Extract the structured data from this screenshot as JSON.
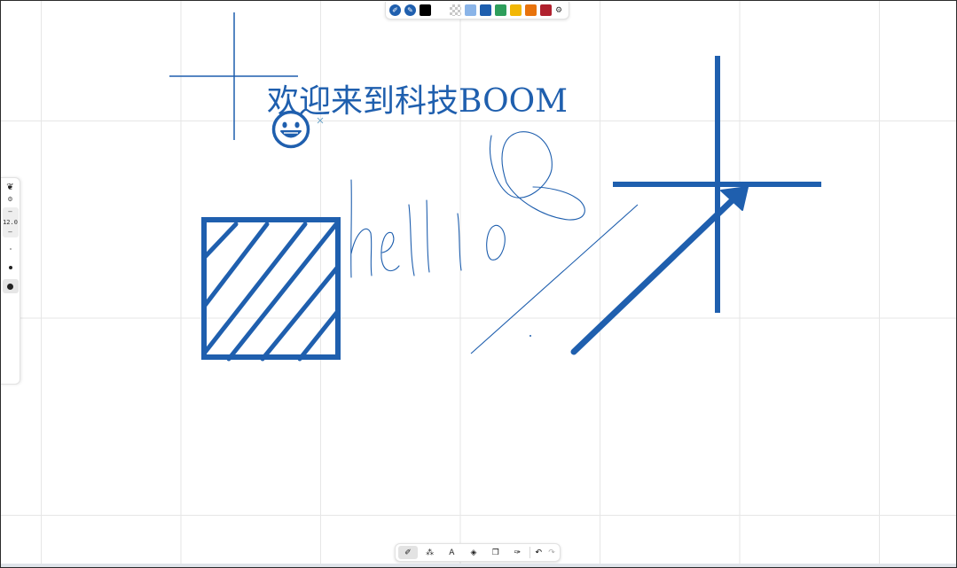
{
  "canvas": {
    "heading_text": "欢迎来到科技BOOM",
    "handwriting_text": "hello",
    "ink_color": "#1f5fae",
    "background": "#ffffff",
    "grid_color": "#e6e6e6"
  },
  "color_toolbar": {
    "modes": [
      {
        "name": "pen-mode-icon",
        "glyph": "✐"
      },
      {
        "name": "marker-mode-icon",
        "glyph": "✎"
      }
    ],
    "swatches": [
      "#000000",
      "#ffffff",
      "transparent",
      "#8ab4e8",
      "#1f5fae",
      "#2e9e5b",
      "#f2b705",
      "#e8730c",
      "#b0212e"
    ],
    "more_glyph": "⚙"
  },
  "stroke_panel": {
    "brush_glyph": "❦",
    "settings_glyph": "⚙",
    "decrease_glyph": "−",
    "size_value": "12.0",
    "increase_glyph": "−"
  },
  "tools_toolbar": {
    "tools": [
      {
        "name": "pen-tool-icon",
        "glyph": "✐"
      },
      {
        "name": "shape-tool-icon",
        "glyph": "⁂"
      },
      {
        "name": "text-tool-icon",
        "glyph": "A"
      },
      {
        "name": "eraser-tool-icon",
        "glyph": "◈"
      },
      {
        "name": "image-tool-icon",
        "glyph": "❐"
      },
      {
        "name": "laser-tool-icon",
        "glyph": "✑"
      }
    ],
    "active_tool_index": 0,
    "undo_glyph": "↶",
    "redo_glyph": "↷"
  }
}
